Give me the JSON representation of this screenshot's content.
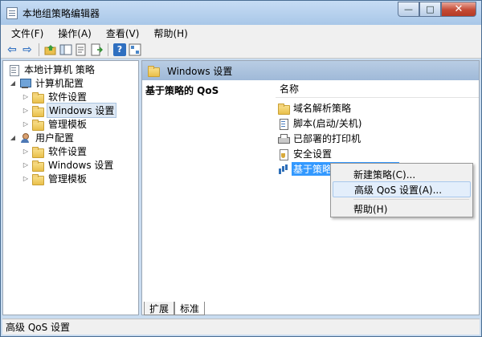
{
  "window": {
    "title": "本地组策略编辑器",
    "controls": {
      "minimize": "—",
      "maximize": "□",
      "close": "✕"
    }
  },
  "menu": [
    {
      "label": "文件(F)"
    },
    {
      "label": "操作(A)"
    },
    {
      "label": "查看(V)"
    },
    {
      "label": "帮助(H)"
    }
  ],
  "toolbar": {
    "back_glyph": "⇦",
    "forward_glyph": "⇨",
    "help_glyph": "?"
  },
  "tree": [
    {
      "label": "本地计算机 策略",
      "icon": "doc-icon",
      "twisty": ""
    },
    {
      "label": "计算机配置",
      "icon": "computer-icon",
      "twisty": "◢"
    },
    {
      "label": "软件设置",
      "icon": "folder-icon",
      "twisty": "▷"
    },
    {
      "label": "Windows 设置",
      "icon": "folder-icon",
      "twisty": "▷"
    },
    {
      "label": "管理模板",
      "icon": "folder-icon",
      "twisty": "▷"
    },
    {
      "label": "用户配置",
      "icon": "user-icon",
      "twisty": "◢"
    },
    {
      "label": "软件设置",
      "icon": "folder-icon",
      "twisty": "▷"
    },
    {
      "label": "Windows 设置",
      "icon": "folder-icon",
      "twisty": "▷"
    },
    {
      "label": "管理模板",
      "icon": "folder-icon",
      "twisty": "▷"
    }
  ],
  "right_pane": {
    "header": "Windows 设置",
    "description_title": "基于策略的 QoS",
    "column_header": "名称",
    "items": [
      {
        "label": "域名解析策略",
        "icon": "folder-icon"
      },
      {
        "label": "脚本(启动/关机)",
        "icon": "script-icon"
      },
      {
        "label": "已部署的打印机",
        "icon": "printer-icon"
      },
      {
        "label": "安全设置",
        "icon": "security-icon"
      },
      {
        "label": "基于策略的 QoS",
        "icon": "qos-bars-icon"
      }
    ],
    "tabs": [
      {
        "label": "扩展"
      },
      {
        "label": "标准"
      }
    ]
  },
  "context_menu": [
    {
      "label": "新建策略(C)..."
    },
    {
      "label": "高级 QoS 设置(A)..."
    },
    {
      "label": "帮助(H)"
    }
  ],
  "status_bar": {
    "text": "高级 QoS 设置"
  }
}
